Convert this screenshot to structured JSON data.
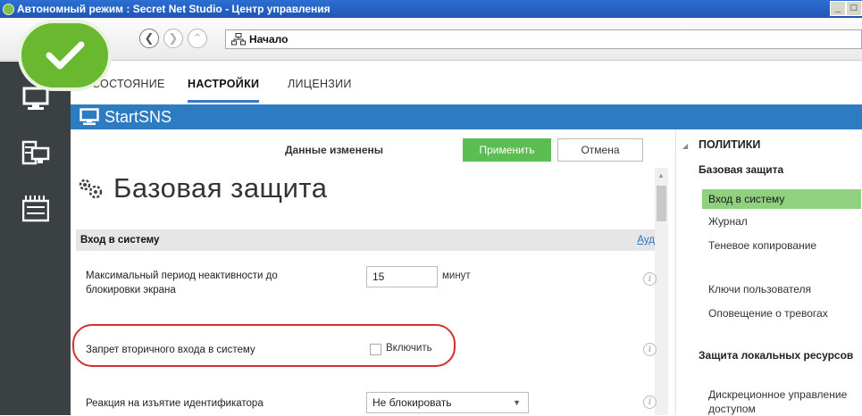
{
  "window": {
    "title": "Автономный режим : Secret Net Studio - Центр управления",
    "buttons": [
      "_",
      "□"
    ]
  },
  "nav": {
    "address": "Начало"
  },
  "tabs": [
    {
      "label": "СОСТОЯНИЕ",
      "active": false
    },
    {
      "label": "НАСТРОЙКИ",
      "active": true
    },
    {
      "label": "ЛИЦЕНЗИИ",
      "active": false
    }
  ],
  "banner": {
    "computer": "StartSNS"
  },
  "toolbar": {
    "status": "Данные изменены",
    "apply": "Применить",
    "cancel": "Отмена"
  },
  "page": {
    "title": "Базовая защита",
    "section": "Вход в систему",
    "section_link": "Ауд",
    "rows": [
      {
        "label_line1": "Максимальный период неактивности до",
        "label_line2": "блокировки экрана",
        "value": "15",
        "unit": "минут"
      },
      {
        "label": "Запрет вторичного входа в систему",
        "checkbox_label": "Включить",
        "checked": false
      },
      {
        "label": "Реакция на изъятие идентификатора",
        "select": "Не блокировать"
      }
    ]
  },
  "right_panel": {
    "header": "ПОЛИТИКИ",
    "group1": "Базовая защита",
    "items1": [
      "Вход в систему",
      "Журнал",
      "Теневое копирование",
      "Ключи пользователя",
      "Оповещение о тревогах"
    ],
    "group2": "Защита локальных ресурсов",
    "items2": [
      "Дискреционное управление доступом"
    ]
  },
  "colors": {
    "accent_blue": "#2d7bc1",
    "apply_green": "#5bbd52",
    "active_item": "#8fd17e",
    "highlight_red": "#d62f2f",
    "sidebar_dark": "#3b4043"
  }
}
